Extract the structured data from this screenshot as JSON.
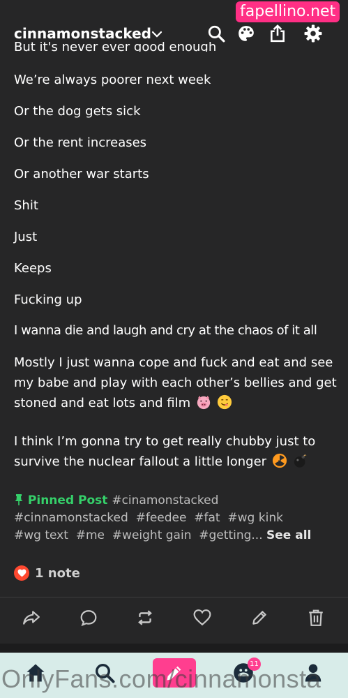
{
  "watermark_top": "fapellino.net",
  "watermark_bottom": "OnlyFans.com/cinnamonsta",
  "header": {
    "blog_name": "cinnamonstacked",
    "icons": [
      "search-icon",
      "palette-icon",
      "share-icon",
      "gear-icon"
    ]
  },
  "post": {
    "cut_line": "But it's never ever good enough",
    "lines": [
      "We’re always poorer next week",
      "Or the dog gets sick",
      "Or the rent increases",
      "Or another war starts",
      "Shit",
      "Just",
      "Keeps",
      "Fucking up",
      "I wanna die and laugh and cry at the chaos of it all"
    ],
    "para1": "Mostly I just wanna cope and fuck and eat and see my babe and play with each other’s bellies and get stoned and eat lots and film",
    "para1_emojis": [
      "pig-face-emoji",
      "smiling-face-emoji"
    ],
    "para2": "I think I’m gonna try to get really chubby just to survive the nuclear fallout a little longer",
    "para2_emojis": [
      "radioactive-emoji",
      "bomb-emoji"
    ]
  },
  "tags": {
    "pinned_label": "Pinned Post",
    "items": [
      "#cinamonstacked",
      "#cinnamonstacked",
      "#feedee",
      "#fat",
      "#wg kink",
      "#wg text",
      "#me",
      "#weight gain",
      "#getting..."
    ],
    "see_all": "See all"
  },
  "notes": {
    "label": "1 note"
  },
  "actions": [
    "share-icon",
    "reply-icon",
    "reblog-icon",
    "like-icon",
    "edit-icon",
    "delete-icon"
  ],
  "bottom_nav": {
    "items": [
      "home-icon",
      "search-icon",
      "compose-icon",
      "activity-icon",
      "account-icon"
    ],
    "activity_badge": "11"
  },
  "colors": {
    "background": "#262627",
    "pinned_green": "#35d06a",
    "heart_red": "#ff4930",
    "accent_pink": "#ff3e8f",
    "nav_bg": "#d8ece9"
  }
}
